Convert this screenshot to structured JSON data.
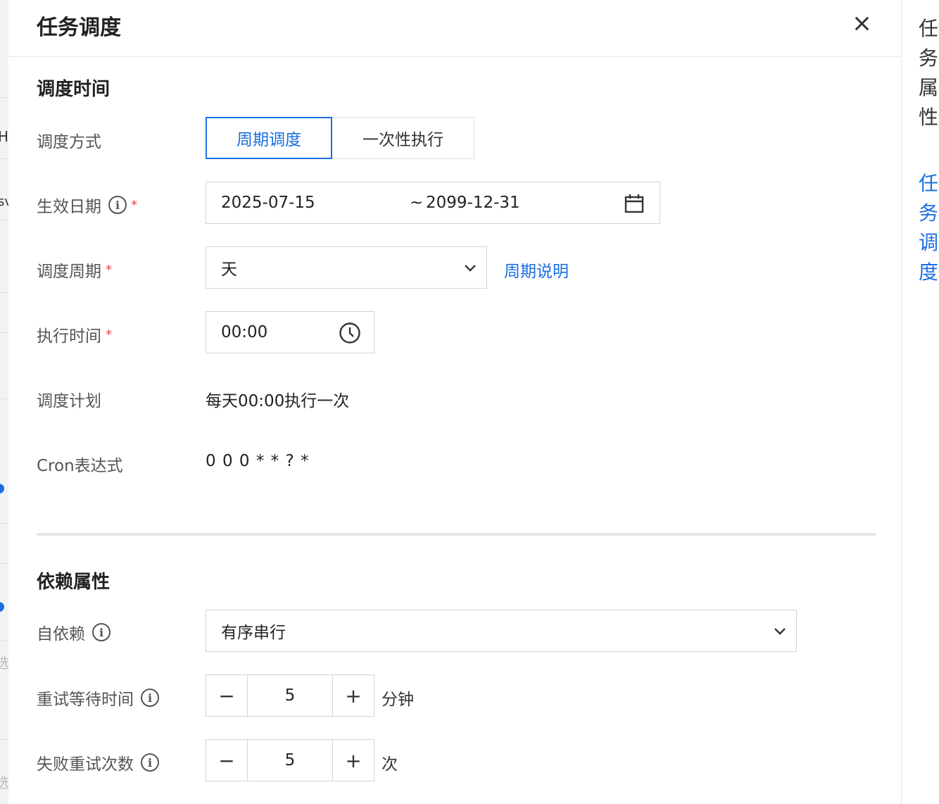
{
  "drawer": {
    "title": "任务调度"
  },
  "background_fragments": {
    "h": "H",
    "sv": "sv",
    "ghost": "选"
  },
  "schedule_time": {
    "section_title": "调度时间",
    "mode": {
      "label": "调度方式",
      "options": [
        "周期调度",
        "一次性执行"
      ],
      "selected": "周期调度"
    },
    "effective_date": {
      "label": "生效日期",
      "start": "2025-07-15",
      "separator": "~",
      "end": "2099-12-31"
    },
    "cycle": {
      "label": "调度周期",
      "value": "天",
      "help_link": "周期说明"
    },
    "exec_time": {
      "label": "执行时间",
      "value": "00:00"
    },
    "plan": {
      "label": "调度计划",
      "value": "每天00:00执行一次"
    },
    "cron": {
      "label": "Cron表达式",
      "value": "0 0 0 * * ? *"
    }
  },
  "dependency": {
    "section_title": "依赖属性",
    "self_dependency": {
      "label": "自依赖",
      "value": "有序串行"
    },
    "retry_wait": {
      "label": "重试等待时间",
      "value": "5",
      "unit": "分钟",
      "minus": "−",
      "plus": "+"
    },
    "retry_count": {
      "label": "失败重试次数",
      "value": "5",
      "unit": "次",
      "minus": "−",
      "plus": "+"
    }
  },
  "right_nav": {
    "items": [
      "任务属性",
      "任务调度"
    ],
    "active": "任务调度"
  },
  "icons": {
    "info_glyph": "i",
    "required_mark": "*"
  },
  "colors": {
    "accent": "#1a6fe0",
    "required": "#e54545"
  }
}
